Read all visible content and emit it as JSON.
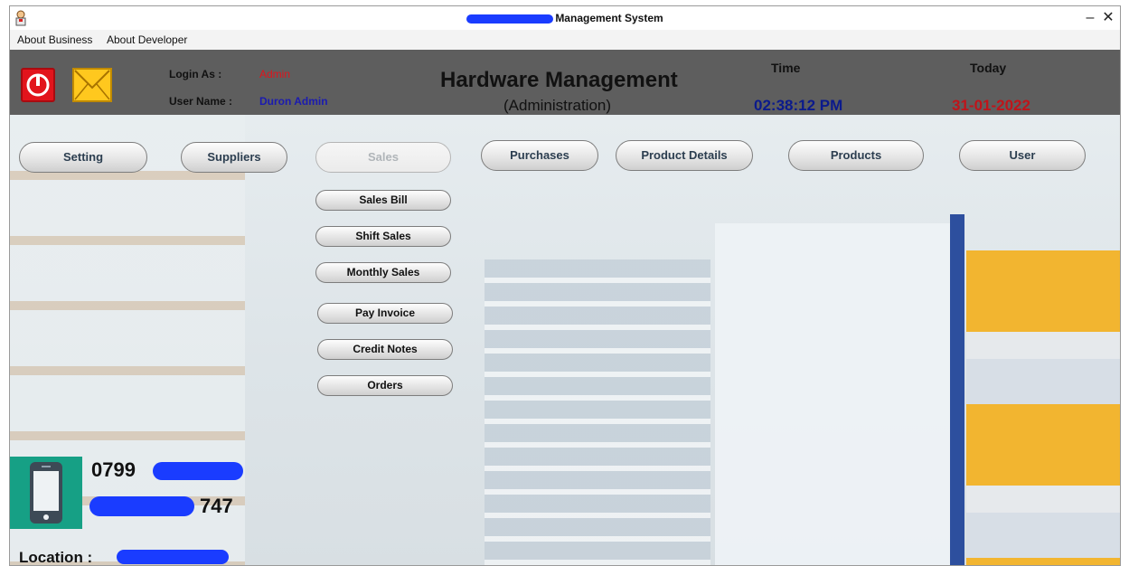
{
  "window": {
    "title": "Management System"
  },
  "menu": {
    "items": [
      "About Business",
      "About Developer"
    ]
  },
  "header": {
    "login_label": "Login As :",
    "login_value": "Admin",
    "user_label": "User Name :",
    "user_value": "Duron Admin",
    "title": "Hardware Management",
    "subtitle": "(Administration)",
    "time_label": "Time",
    "time_value": "02:38:12 PM",
    "date_label": "Today",
    "date_value": "31-01-2022"
  },
  "nav": {
    "setting": "Setting",
    "suppliers": "Suppliers",
    "sales": "Sales",
    "purchases": "Purchases",
    "product_details": "Product Details",
    "products": "Products",
    "user": "User"
  },
  "sales_menu": {
    "sales_bill": "Sales Bill",
    "shift_sales": "Shift Sales",
    "monthly_sales": "Monthly Sales",
    "pay_invoice": "Pay Invoice",
    "credit_notes": "Credit Notes",
    "orders": "Orders"
  },
  "contact": {
    "phone_prefix": "0799",
    "phone_suffix": "747",
    "location_label": "Location :"
  },
  "colors": {
    "header_bg": "#5e5e5e",
    "admin_red": "#e0141c",
    "user_blue": "#1b1bb0",
    "time_blue": "#0b1a8c",
    "date_red": "#c0141a",
    "redaction_blue": "#1a3cff"
  },
  "icons": [
    "app-icon",
    "power-icon",
    "mail-icon",
    "phone-icon",
    "minimize-icon",
    "close-icon"
  ]
}
